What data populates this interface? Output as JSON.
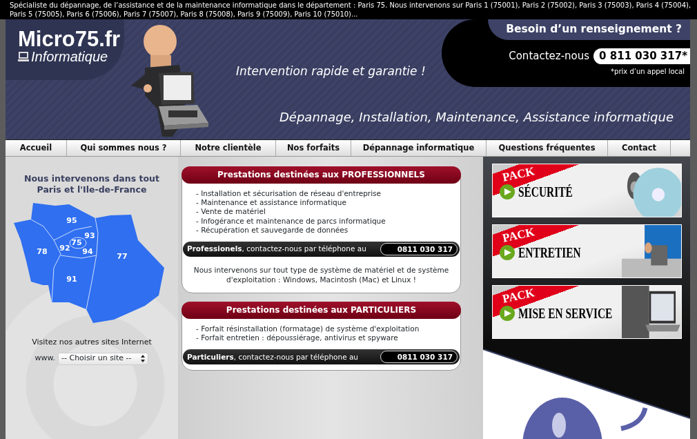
{
  "top_banner": "Spécialiste du dépannage, de l’assistance et de la maintenance informatique dans le département : Paris 75. Nous intervenons sur Paris 1 (75001), Paris 2 (75002), Paris 3 (75003), Paris 4 (75004), Paris 5 (75005), Paris 6 (75006), Paris 7 (75007), Paris 8 (75008), Paris 9 (75009), Paris 10 (75010)...",
  "header": {
    "logo_title": "Micro75.fr",
    "logo_subtitle": "Informatique",
    "tagline": "Intervention rapide et garantie !",
    "services": "Dépannage, Installation, Maintenance, Assistance informatique",
    "contact_heading": "Besoin d’un renseignement ?",
    "contact_label": "Contactez-nous",
    "phone": "0 811 030 317*",
    "phone_note": "*prix d’un appel local"
  },
  "nav": [
    {
      "label": "Accueil"
    },
    {
      "label": "Qui sommes nous ?"
    },
    {
      "label": "Notre clientèle"
    },
    {
      "label": "Nos forfaits"
    },
    {
      "label": "Dépannage informatique"
    },
    {
      "label": "Questions fréquentes"
    },
    {
      "label": "Contact"
    }
  ],
  "map_section": {
    "title": "Nous intervenons dans tout Paris et l'Ile-de-France",
    "departments": [
      "95",
      "93",
      "75",
      "92",
      "78",
      "94",
      "77",
      "91"
    ],
    "sites_label": "Visitez nos autres sites Internet",
    "sites_prefix": "www.",
    "sites_select": "-- Choisir un site --"
  },
  "panels": [
    {
      "title": "Prestations destinées aux PROFESSIONNELS",
      "items": [
        "- Installation et sécurisation de réseau d'entreprise",
        "- Maintenance et assistance informatique",
        "- Vente de matériel",
        "- Infogérance et maintenance de parcs informatique",
        "- Récupération et sauvegarde de données"
      ],
      "contact_lead": "Professionels",
      "contact_rest": ", contactez-nous par téléphone au",
      "phone": "0811 030 317",
      "note": "Nous intervenons sur tout type de système de matériel et de système d'exploitation : Windows, Macintosh (Mac) et Linux !"
    },
    {
      "title": "Prestations destinées aux PARTICULIERS",
      "items": [
        "- Forfait résinstallation (formatage) de système d'exploitation",
        "- Forfait entretien : dépoussiérage, antivirus et spyware"
      ],
      "contact_lead": "Particuliers",
      "contact_rest": ", contactez-nous par téléphone au",
      "phone": "0811 030 317"
    }
  ],
  "packs": [
    {
      "label": "PACK",
      "name": "SÉCURITÉ"
    },
    {
      "label": "PACK",
      "name": "ENTRETIEN"
    },
    {
      "label": "PACK",
      "name": "MISE EN SERVICE"
    }
  ]
}
